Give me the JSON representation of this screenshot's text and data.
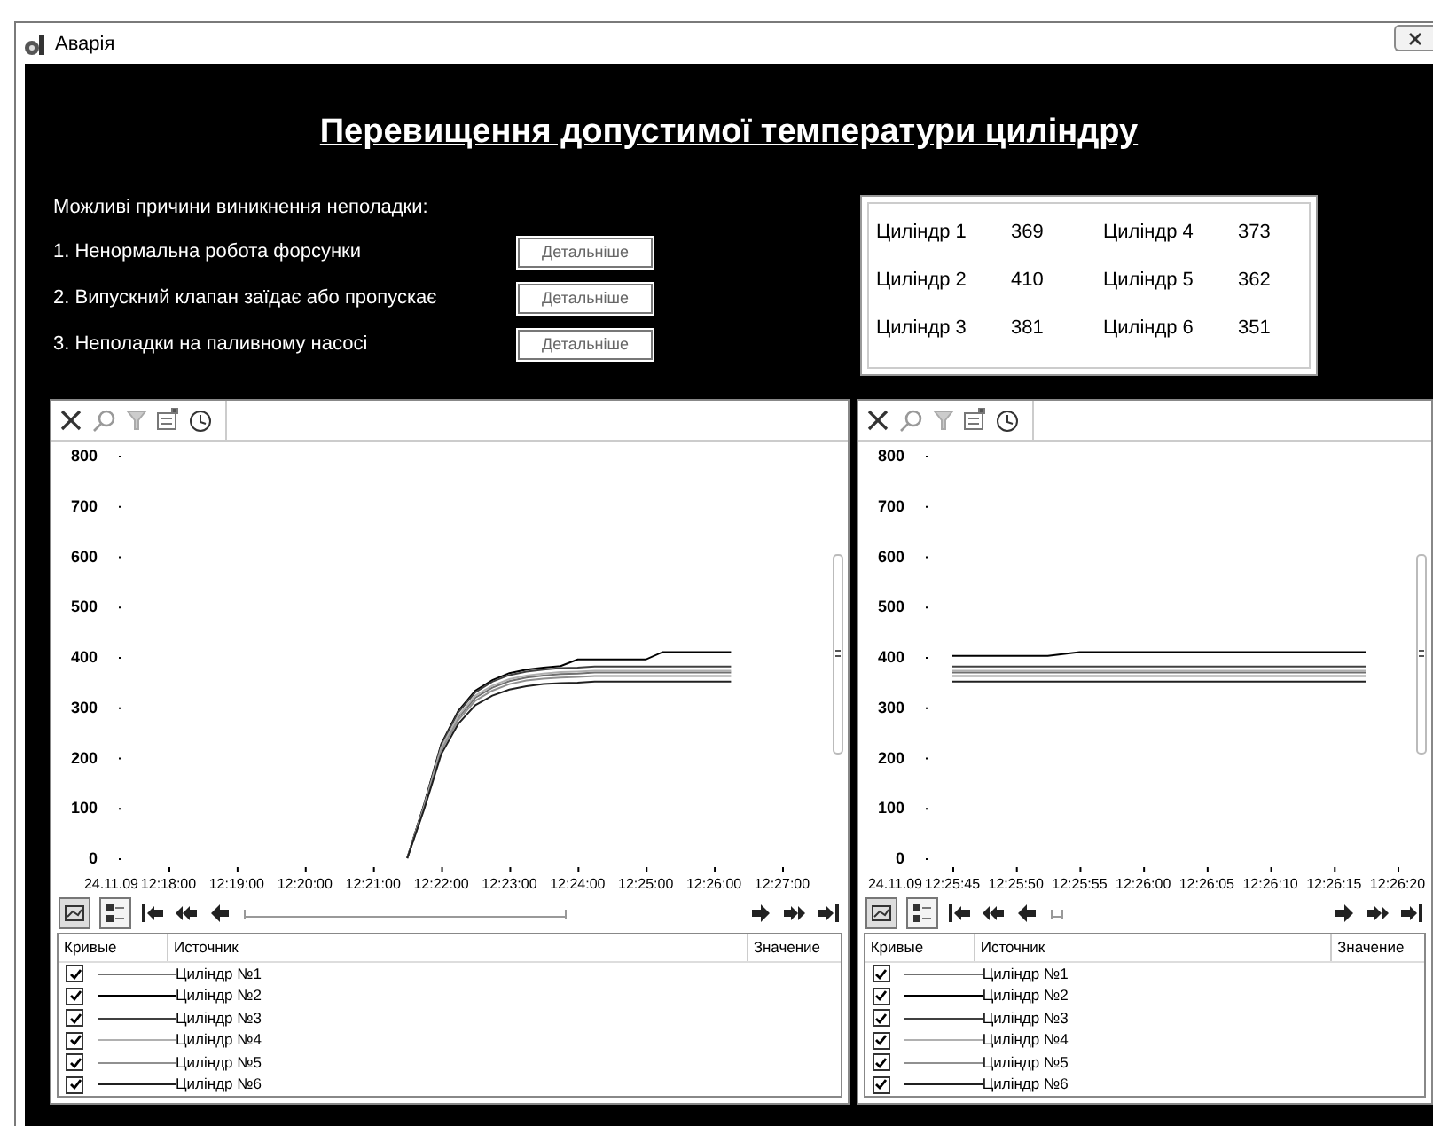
{
  "window": {
    "title": "Аварія"
  },
  "heading": "Перевищення допустимої температури циліндру",
  "causes": {
    "title": "Можливі причини виникнення неполадки:",
    "items": [
      {
        "text": "1. Ненормальна робота форсунки",
        "button": "Детальніше"
      },
      {
        "text": "2. Випускний клапан заїдає або пропускає",
        "button": "Детальніше"
      },
      {
        "text": "3. Неполадки на паливному насосі",
        "button": "Детальніше"
      }
    ]
  },
  "cylinders": [
    {
      "name": "Циліндр 1",
      "value": "369"
    },
    {
      "name": "Циліндр 2",
      "value": "410"
    },
    {
      "name": "Циліндр 3",
      "value": "381"
    },
    {
      "name": "Циліндр 4",
      "value": "373"
    },
    {
      "name": "Циліндр 5",
      "value": "362"
    },
    {
      "name": "Циліндр 6",
      "value": "351"
    }
  ],
  "panels": [
    {
      "date_label": "24.11.09",
      "chart_data": {
        "type": "line",
        "categories": [
          "12:18:00",
          null,
          null,
          null,
          "12:19:00",
          null,
          null,
          null,
          "12:20:00",
          null,
          null,
          null,
          "12:21:00",
          null,
          null,
          null,
          "12:22:00",
          null,
          null,
          null,
          "12:23:00",
          null,
          null,
          null,
          "12:24:00",
          null,
          null,
          null,
          "12:25:00",
          null,
          null,
          null,
          "12:26:00",
          null,
          null,
          null,
          "12:27:00"
        ],
        "ylim": [
          0,
          800
        ],
        "yticks": [
          0,
          100,
          200,
          300,
          400,
          500,
          600,
          700,
          800
        ],
        "series": [
          {
            "color": "#707070",
            "values": [
              null,
              null,
              null,
              null,
              null,
              null,
              null,
              null,
              null,
              null,
              null,
              null,
              null,
              null,
              0,
              103,
              218,
              280,
              319,
              339,
              352,
              359,
              363,
              366,
              367,
              369,
              369,
              369,
              369,
              369,
              369,
              369,
              369,
              369,
              null,
              null,
              null
            ]
          },
          {
            "color": "#000000",
            "values": [
              null,
              null,
              null,
              null,
              null,
              null,
              null,
              null,
              null,
              null,
              null,
              null,
              null,
              null,
              0,
              108,
              227,
              293,
              333,
              354,
              368,
              375,
              379,
              382,
              395,
              395,
              395,
              395,
              395,
              410,
              410,
              410,
              410,
              410,
              null,
              null,
              null
            ]
          },
          {
            "color": "#404040",
            "values": [
              null,
              null,
              null,
              null,
              null,
              null,
              null,
              null,
              null,
              null,
              null,
              null,
              null,
              null,
              0,
              107,
              225,
              290,
              330,
              351,
              364,
              371,
              375,
              378,
              379,
              381,
              381,
              381,
              381,
              381,
              381,
              381,
              381,
              381,
              null,
              null,
              null
            ]
          },
          {
            "color": "#b0b0b0",
            "values": [
              null,
              null,
              null,
              null,
              null,
              null,
              null,
              null,
              null,
              null,
              null,
              null,
              null,
              null,
              0,
              104,
              220,
              283,
              323,
              343,
              356,
              363,
              367,
              370,
              371,
              373,
              373,
              373,
              373,
              373,
              373,
              373,
              373,
              373,
              null,
              null,
              null
            ]
          },
          {
            "color": "#909090",
            "values": [
              null,
              null,
              null,
              null,
              null,
              null,
              null,
              null,
              null,
              null,
              null,
              null,
              null,
              null,
              0,
              101,
              214,
              275,
              313,
              333,
              346,
              353,
              357,
              359,
              360,
              362,
              362,
              362,
              362,
              362,
              362,
              362,
              362,
              362,
              null,
              null,
              null
            ]
          },
          {
            "color": "#202020",
            "values": [
              null,
              null,
              null,
              null,
              null,
              null,
              null,
              null,
              null,
              null,
              null,
              null,
              null,
              null,
              0,
              98,
              207,
              267,
              304,
              323,
              335,
              342,
              346,
              348,
              349,
              351,
              351,
              351,
              351,
              351,
              351,
              351,
              351,
              351,
              null,
              null,
              null
            ]
          }
        ]
      },
      "legend": {
        "columns": [
          "Кривые",
          "Источник",
          "Значение"
        ],
        "rows": [
          {
            "checked": true,
            "color": "#707070",
            "name": "Циліндр №1"
          },
          {
            "checked": true,
            "color": "#000000",
            "name": "Циліндр №2"
          },
          {
            "checked": true,
            "color": "#404040",
            "name": "Циліндр №3"
          },
          {
            "checked": true,
            "color": "#b0b0b0",
            "name": "Циліндр №4"
          },
          {
            "checked": true,
            "color": "#909090",
            "name": "Циліндр №5"
          },
          {
            "checked": true,
            "color": "#202020",
            "name": "Циліндр №6"
          }
        ]
      }
    },
    {
      "date_label": "24.11.09",
      "chart_data": {
        "type": "line",
        "categories": [
          "12:25:45",
          null,
          "12:25:50",
          null,
          "12:25:55",
          null,
          "12:26:00",
          null,
          "12:26:05",
          null,
          "12:26:10",
          null,
          "12:26:15",
          null,
          "12:26:20"
        ],
        "ylim": [
          0,
          800
        ],
        "yticks": [
          0,
          100,
          200,
          300,
          400,
          500,
          600,
          700,
          800
        ],
        "series": [
          {
            "color": "#707070",
            "values": [
              369,
              369,
              369,
              369,
              369,
              369,
              369,
              369,
              369,
              369,
              369,
              369,
              369,
              369,
              null
            ]
          },
          {
            "color": "#000000",
            "values": [
              402,
              402,
              402,
              402,
              410,
              410,
              410,
              410,
              410,
              410,
              410,
              410,
              410,
              410,
              null
            ]
          },
          {
            "color": "#404040",
            "values": [
              381,
              381,
              381,
              381,
              381,
              381,
              381,
              381,
              381,
              381,
              381,
              381,
              381,
              381,
              null
            ]
          },
          {
            "color": "#b0b0b0",
            "values": [
              373,
              373,
              373,
              373,
              373,
              373,
              373,
              373,
              373,
              373,
              373,
              373,
              373,
              373,
              null
            ]
          },
          {
            "color": "#909090",
            "values": [
              362,
              362,
              362,
              362,
              362,
              362,
              362,
              362,
              362,
              362,
              362,
              362,
              362,
              362,
              null
            ]
          },
          {
            "color": "#202020",
            "values": [
              351,
              351,
              351,
              351,
              351,
              351,
              351,
              351,
              351,
              351,
              351,
              351,
              351,
              351,
              null
            ]
          }
        ]
      },
      "legend": {
        "columns": [
          "Кривые",
          "Источник",
          "Значение"
        ],
        "rows": [
          {
            "checked": true,
            "color": "#707070",
            "name": "Циліндр №1"
          },
          {
            "checked": true,
            "color": "#000000",
            "name": "Циліндр №2"
          },
          {
            "checked": true,
            "color": "#404040",
            "name": "Циліндр №3"
          },
          {
            "checked": true,
            "color": "#b0b0b0",
            "name": "Циліндр №4"
          },
          {
            "checked": true,
            "color": "#909090",
            "name": "Циліндр №5"
          },
          {
            "checked": true,
            "color": "#202020",
            "name": "Циліндр №6"
          }
        ]
      }
    }
  ]
}
